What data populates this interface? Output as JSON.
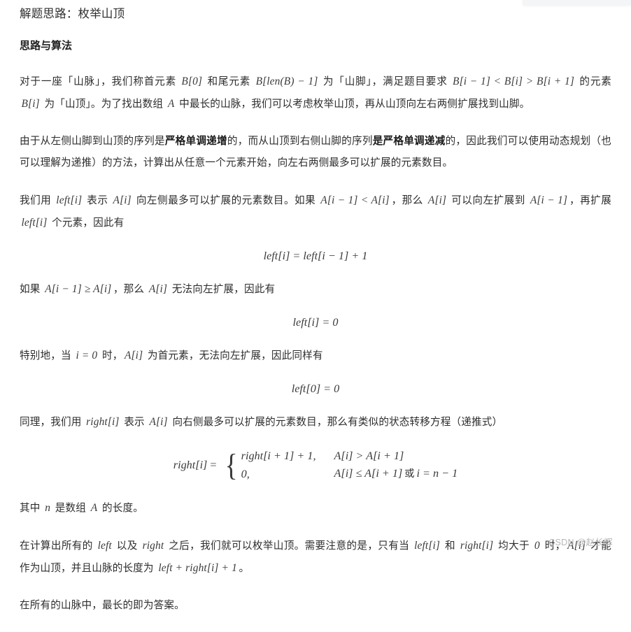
{
  "document": {
    "title": "解题思路：枚举山顶",
    "subtitle": "思路与算法"
  },
  "paragraphs": {
    "p1": {
      "s1": "对于一座「山脉」，我们称首元素 ",
      "m1": "B[0]",
      "s2": " 和尾元素 ",
      "m2": "B[len(B) − 1]",
      "s3": " 为「山脚」，满足题目要求 ",
      "m3": "B[i − 1] < B[i] > B[i + 1]",
      "s4": " 的元素 ",
      "m4": "B[i]",
      "s5": " 为「山顶」。为了找出数组 ",
      "m5": "A",
      "s6": " 中最长的山脉，我们可以考虑枚举山顶，再从山顶向左右两侧扩展找到山脚。"
    },
    "p2": {
      "s1": "由于从左侧山脚到山顶的序列是",
      "b1": "严格单调递增",
      "s2": "的，而从山顶到右侧山脚的序列",
      "b2": "是严格单调递减",
      "s3": "的，因此我们可以使用动态规划（也可以理解为递推）的方法，计算出从任意一个元素开始，向左右两侧最多可以扩展的元素数目。"
    },
    "p3": {
      "s1": "我们用 ",
      "m1": "left[i]",
      "s2": " 表示 ",
      "m2": "A[i]",
      "s3": " 向左侧最多可以扩展的元素数目。如果 ",
      "m3": "A[i − 1] < A[i]",
      "s4": "，那么 ",
      "m4": "A[i]",
      "s5": " 可以向左扩展到 ",
      "m5": "A[i − 1]",
      "s6": "，再扩展 ",
      "m6": "left[i]",
      "s7": " 个元素，因此有"
    },
    "p4": {
      "s1": "如果 ",
      "m1": "A[i − 1] ≥ A[i]",
      "s2": "，那么 ",
      "m2": "A[i]",
      "s3": " 无法向左扩展，因此有"
    },
    "p5": {
      "s1": "特别地，当 ",
      "m1": "i = 0",
      "s2": " 时，",
      "m2": "A[i]",
      "s3": " 为首元素，无法向左扩展，因此同样有"
    },
    "p6": {
      "s1": "同理，我们用 ",
      "m1": "right[i]",
      "s2": " 表示 ",
      "m2": "A[i]",
      "s3": " 向右侧最多可以扩展的元素数目，那么有类似的状态转移方程（递推式）"
    },
    "p7": {
      "s1": "其中 ",
      "m1": "n",
      "s2": " 是数组 ",
      "m2": "A",
      "s3": " 的长度。"
    },
    "p8": {
      "s1": "在计算出所有的 ",
      "m1": "left",
      "s2": " 以及 ",
      "m2": "right",
      "s3": " 之后，我们就可以枚举山顶。需要注意的是，只有当 ",
      "m3": "left[i]",
      "s4": " 和 ",
      "m4": "right[i]",
      "s5": " 均大于 ",
      "m5": "0",
      "s6": " 时，",
      "m6": "A[i]",
      "s7": " 才能作为山顶，并且山脉的长度为 ",
      "m7": "left + right[i] + 1",
      "s8": "。"
    },
    "p9": {
      "s1": "在所有的山脉中，最长的即为答案。"
    }
  },
  "equations": {
    "eq1": {
      "lhs": "left[i]",
      "op": "=",
      "rhs": "left[i − 1] + 1",
      "full": "left[i] = left[i − 1] + 1"
    },
    "eq2": {
      "lhs": "left[i]",
      "op": "=",
      "rhs": "0",
      "full": "left[i] = 0"
    },
    "eq3": {
      "lhs": "left[0]",
      "op": "=",
      "rhs": "0",
      "full": "left[0] = 0"
    },
    "eq_cases": {
      "lhs": "right[i]",
      "op": "=",
      "case1_value": "right[i + 1] + 1,",
      "case1_cond_a": "A[i] > A[i + 1]",
      "case2_value": "0,",
      "case2_cond_a": "A[i] ≤ A[i + 1]",
      "case2_cond_join": "或",
      "case2_cond_b": "i = n − 1"
    }
  },
  "watermark": {
    "text": "CSDN @赵长辉"
  },
  "colors": {
    "text": "#2d2d2d",
    "math": "#3a3a3a",
    "watermark": "#b6b6b6",
    "background": "#ffffff",
    "panel": "#f4f5f7"
  }
}
